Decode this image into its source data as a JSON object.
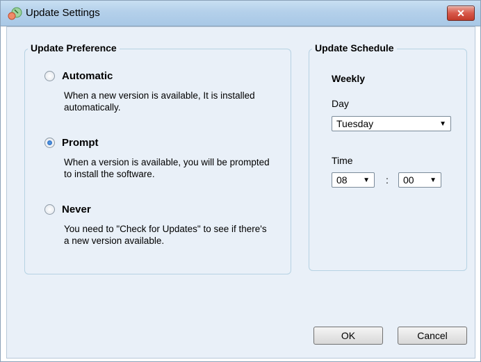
{
  "window": {
    "title": "Update Settings"
  },
  "preference": {
    "title": "Update Preference",
    "options": [
      {
        "label": "Automatic",
        "description": "When a new version is available, It is installed automatically.",
        "selected": false
      },
      {
        "label": "Prompt",
        "description": "When a version is available, you will be prompted to install the software.",
        "selected": true
      },
      {
        "label": "Never",
        "description": "You need to \"Check for Updates\" to see if there's a new version available.",
        "selected": false
      }
    ]
  },
  "schedule": {
    "title": "Update Schedule",
    "frequency": "Weekly",
    "day_label": "Day",
    "day_value": "Tuesday",
    "time_label": "Time",
    "hour_value": "08",
    "minute_value": "00",
    "separator": ":"
  },
  "buttons": {
    "ok": "OK",
    "cancel": "Cancel"
  }
}
